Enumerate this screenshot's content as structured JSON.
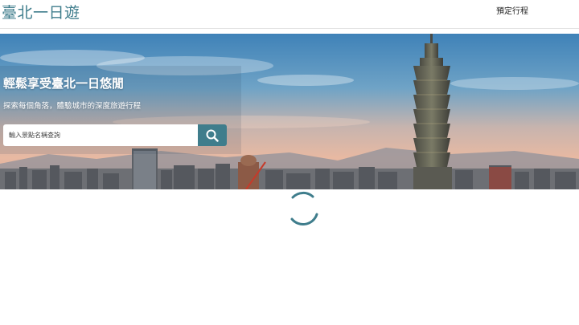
{
  "navbar": {
    "brand": "臺北一日遊",
    "links": [
      {
        "label": "預定行程"
      }
    ]
  },
  "hero": {
    "title": "輕鬆享受臺北一日悠閒",
    "subtitle": "探索每個角落，體驗城市的深度旅遊行程",
    "search": {
      "placeholder": "輸入景點名稱查詢",
      "value": "",
      "button_icon": "search-icon"
    }
  },
  "loading": {
    "icon": "loading-spinner-icon"
  },
  "colors": {
    "brand": "#3f7d8c",
    "text": "#222222",
    "background": "#ffffff"
  }
}
